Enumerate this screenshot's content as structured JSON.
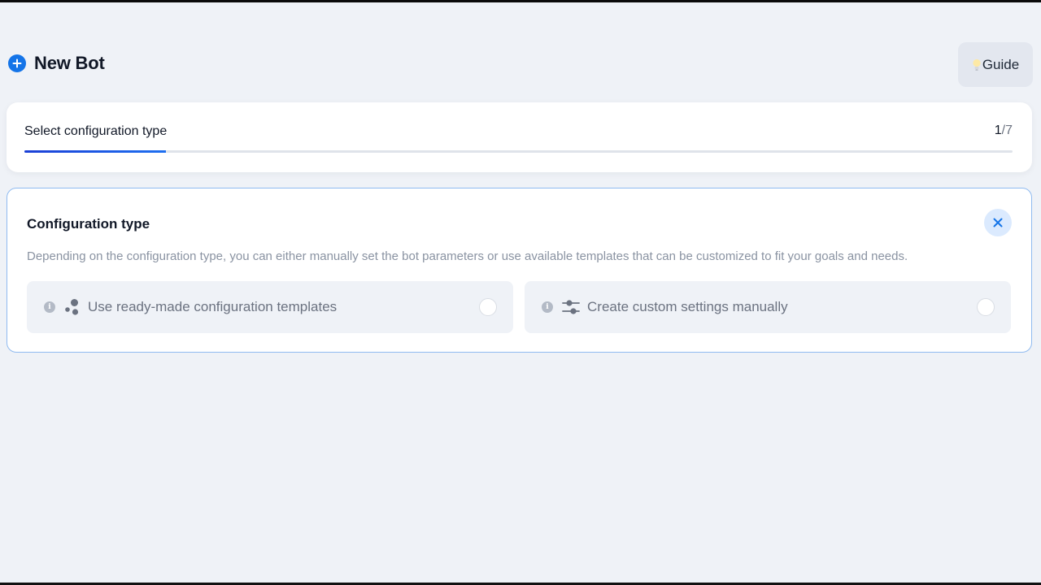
{
  "header": {
    "title": "New Bot",
    "guide_label": "Guide"
  },
  "progress": {
    "label": "Select configuration type",
    "current_step": "1",
    "total_step": "/7",
    "fraction": 0.143
  },
  "config": {
    "title": "Configuration type",
    "description": "Depending on the configuration type, you can either manually set the bot parameters or use available templates that can be customized to fit your goals and needs.",
    "options": [
      {
        "label": "Use ready-made configuration templates",
        "icon": "templates-icon",
        "selected": false
      },
      {
        "label": "Create custom settings manually",
        "icon": "sliders-icon",
        "selected": false
      }
    ]
  },
  "colors": {
    "accent": "#1474e8",
    "progress_fill": "#1b3fd6",
    "card_border": "#8fbaf0",
    "background": "#eff2f7"
  }
}
